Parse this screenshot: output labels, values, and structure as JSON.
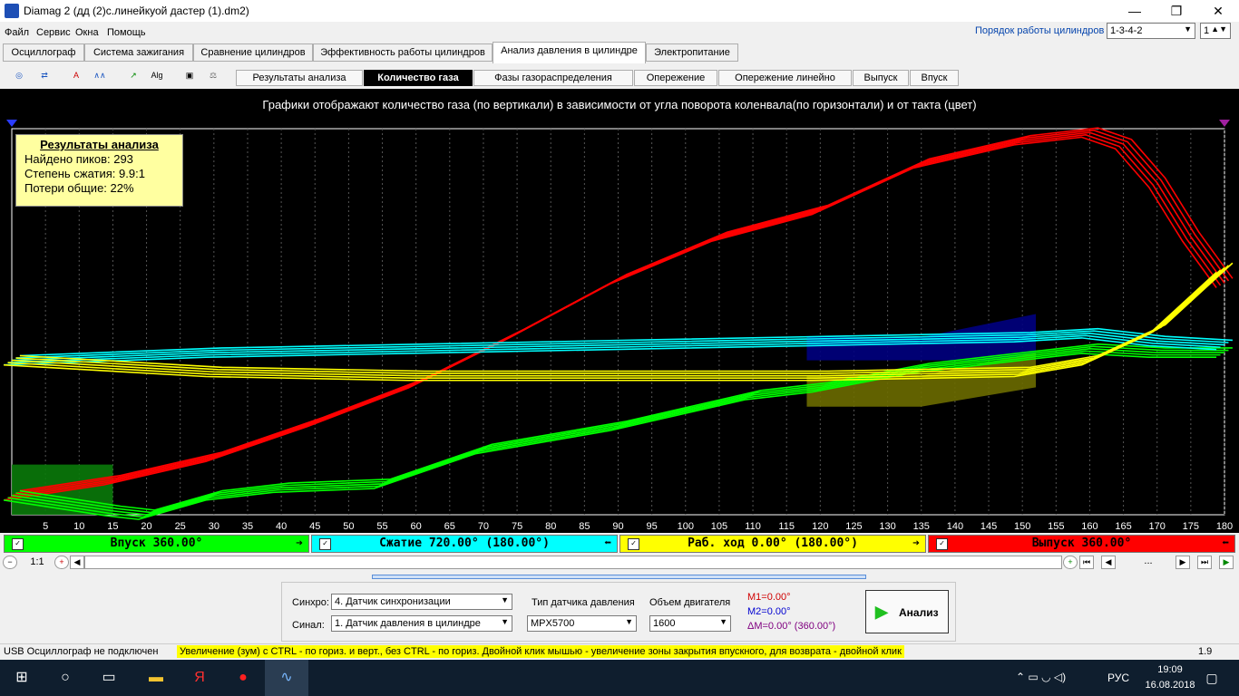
{
  "window": {
    "title": "Diamag 2 (дд (2)с.линейкуой дастер (1).dm2)",
    "minimize_glyph": "—",
    "maximize_glyph": "❐",
    "close_glyph": "✕"
  },
  "menu": {
    "items": [
      "Файл",
      "Сервис",
      "Окна",
      "Помощь"
    ],
    "cylinder_order_label": "Порядок работы цилиндров",
    "cylinder_order_value": "1-3-4-2",
    "cylinder_index_value": "1"
  },
  "main_tabs": [
    "Осциллограф",
    "Система зажигания",
    "Сравнение цилиндров",
    "Эффективность работы цилиндров",
    "Анализ давления в цилиндре",
    "Электропитание"
  ],
  "active_main_tab": "Анализ давления в цилиндре",
  "toolbar_icons": [
    "scope-icon",
    "counter-icon",
    "auto-icon",
    "waveform-icon",
    "trend-icon",
    "algorithm-icon",
    "save-icon",
    "scales-icon"
  ],
  "sub_tabs": [
    "Результаты анализа",
    "Количество газа",
    "Фазы газораспределения",
    "Опережение",
    "Опережение линейно",
    "Выпуск",
    "Впуск"
  ],
  "active_sub_tab": "Количество газа",
  "chart": {
    "description": "Графики отображают количество газа (по вертикали) в зависимости от угла поворота коленвала(по горизонтали) и от такта (цвет)"
  },
  "analysis_box": {
    "title": "Результаты анализа",
    "lines": [
      "Найдено пиков: 293",
      "Степень сжатия: 9.9:1",
      "Потери общие: 22%"
    ]
  },
  "chart_data": {
    "type": "line",
    "x_ticks": [
      5,
      10,
      15,
      20,
      25,
      30,
      35,
      40,
      45,
      50,
      55,
      60,
      65,
      70,
      75,
      80,
      85,
      90,
      95,
      100,
      105,
      110,
      115,
      120,
      125,
      130,
      135,
      140,
      145,
      150,
      155,
      160,
      165,
      170,
      175,
      180
    ],
    "xlim": [
      0,
      180
    ],
    "ylim": [
      0,
      1
    ],
    "grid": true,
    "series": [
      {
        "color": "#ff0000",
        "x": [
          0,
          15,
          30,
          45,
          60,
          75,
          90,
          105,
          120,
          135,
          150,
          160,
          165,
          170,
          175,
          180
        ],
        "y": [
          0.05,
          0.09,
          0.15,
          0.24,
          0.34,
          0.47,
          0.61,
          0.72,
          0.79,
          0.91,
          0.97,
          0.99,
          0.96,
          0.86,
          0.72,
          0.6
        ]
      },
      {
        "color": "#00ff00",
        "x": [
          0,
          15,
          20,
          30,
          40,
          55,
          70,
          90,
          110,
          120,
          135,
          150,
          160,
          170,
          180
        ],
        "y": [
          0.05,
          0.01,
          0.0,
          0.05,
          0.07,
          0.08,
          0.17,
          0.23,
          0.31,
          0.33,
          0.38,
          0.41,
          0.43,
          0.42,
          0.42
        ]
      },
      {
        "color": "#00ffff",
        "x": [
          0,
          30,
          60,
          90,
          120,
          150,
          160,
          170,
          180
        ],
        "y": [
          0.4,
          0.42,
          0.43,
          0.44,
          0.45,
          0.46,
          0.47,
          0.45,
          0.44
        ]
      },
      {
        "color": "#ffff00",
        "x": [
          0,
          30,
          60,
          90,
          120,
          150,
          160,
          170,
          175,
          180
        ],
        "y": [
          0.4,
          0.37,
          0.36,
          0.36,
          0.36,
          0.37,
          0.4,
          0.48,
          0.56,
          0.64
        ]
      }
    ]
  },
  "strokes": [
    {
      "label": "Впуск 360.00°",
      "color": "#00ff00",
      "arrow": "➔"
    },
    {
      "label": "Сжатие 720.00° (180.00°)",
      "color": "#00ffff",
      "arrow": "⬅"
    },
    {
      "label": "Раб. ход 0.00° (180.00°)",
      "color": "#ffff00",
      "arrow": "➔"
    },
    {
      "label": "Выпуск 360.00°",
      "color": "#ff0000",
      "arrow": "⬅"
    }
  ],
  "zoom_label": "1:1",
  "scroll_dots": "...",
  "panel": {
    "sync_label": "Синхро:",
    "sync_value": "4.  Датчик синхронизации",
    "signal_label": "Синал:",
    "signal_value": "1.  Датчик давления в цилиндре",
    "sensor_type_label": "Тип датчика давления",
    "sensor_type_value": "MPX5700",
    "engine_volume_label": "Объем двигателя",
    "engine_volume_value": "1600",
    "m1": "M1=0.00°",
    "m2": "M2=0.00°",
    "dm": "ΔM=0.00° (360.00°)",
    "analyze_label": "Анализ"
  },
  "status": {
    "usb": "USB Осциллограф не подключен",
    "hint": "Увеличение (зум) с CTRL - по гориз. и верт., без CTRL - по гориз.  Двойной клик мышью - увеличение зоны закрытия впускного, для возврата - двойной клик",
    "version": "1.9"
  },
  "taskbar": {
    "lang": "РУС",
    "time": "19:09",
    "date": "16.08.2018"
  }
}
